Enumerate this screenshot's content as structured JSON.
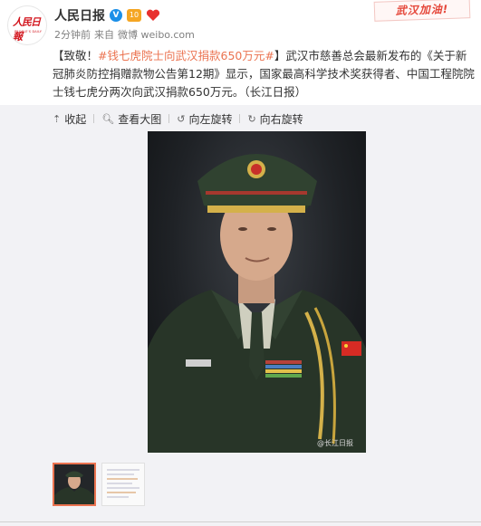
{
  "header": {
    "account_name": "人民日报",
    "logo_text": "人民日報",
    "logo_sub": "PEOPLE'S DAILY",
    "badge_medal": "V",
    "badge_level": "10",
    "time": "2分钟前",
    "source_prefix": "来自",
    "source": "微博 weibo.com"
  },
  "stamp": {
    "text": "武汉加油!"
  },
  "post": {
    "prefix": "【致敬！",
    "topic": "#钱七虎院士向武汉捐款650万元#",
    "body": "】武汉市慈善总会最新发布的《关于新冠肺炎防控捐赠款物公告第12期》显示，国家最高科学技术奖获得者、中国工程院院士钱七虎分两次向武汉捐款650万元。（长江日报）"
  },
  "media": {
    "toolbar": {
      "collapse": "收起",
      "view_large": "查看大图",
      "rotate_left": "向左旋转",
      "rotate_right": "向右旋转"
    },
    "watermark": "@长江日报",
    "thumbnails": [
      {
        "label": "photo",
        "active": true
      },
      {
        "label": "document",
        "active": false
      }
    ]
  },
  "colors": {
    "topic": "#eb7350",
    "verified": "#1b8fe8",
    "logo": "#d2141c",
    "media_bg": "#f2f2f5"
  }
}
